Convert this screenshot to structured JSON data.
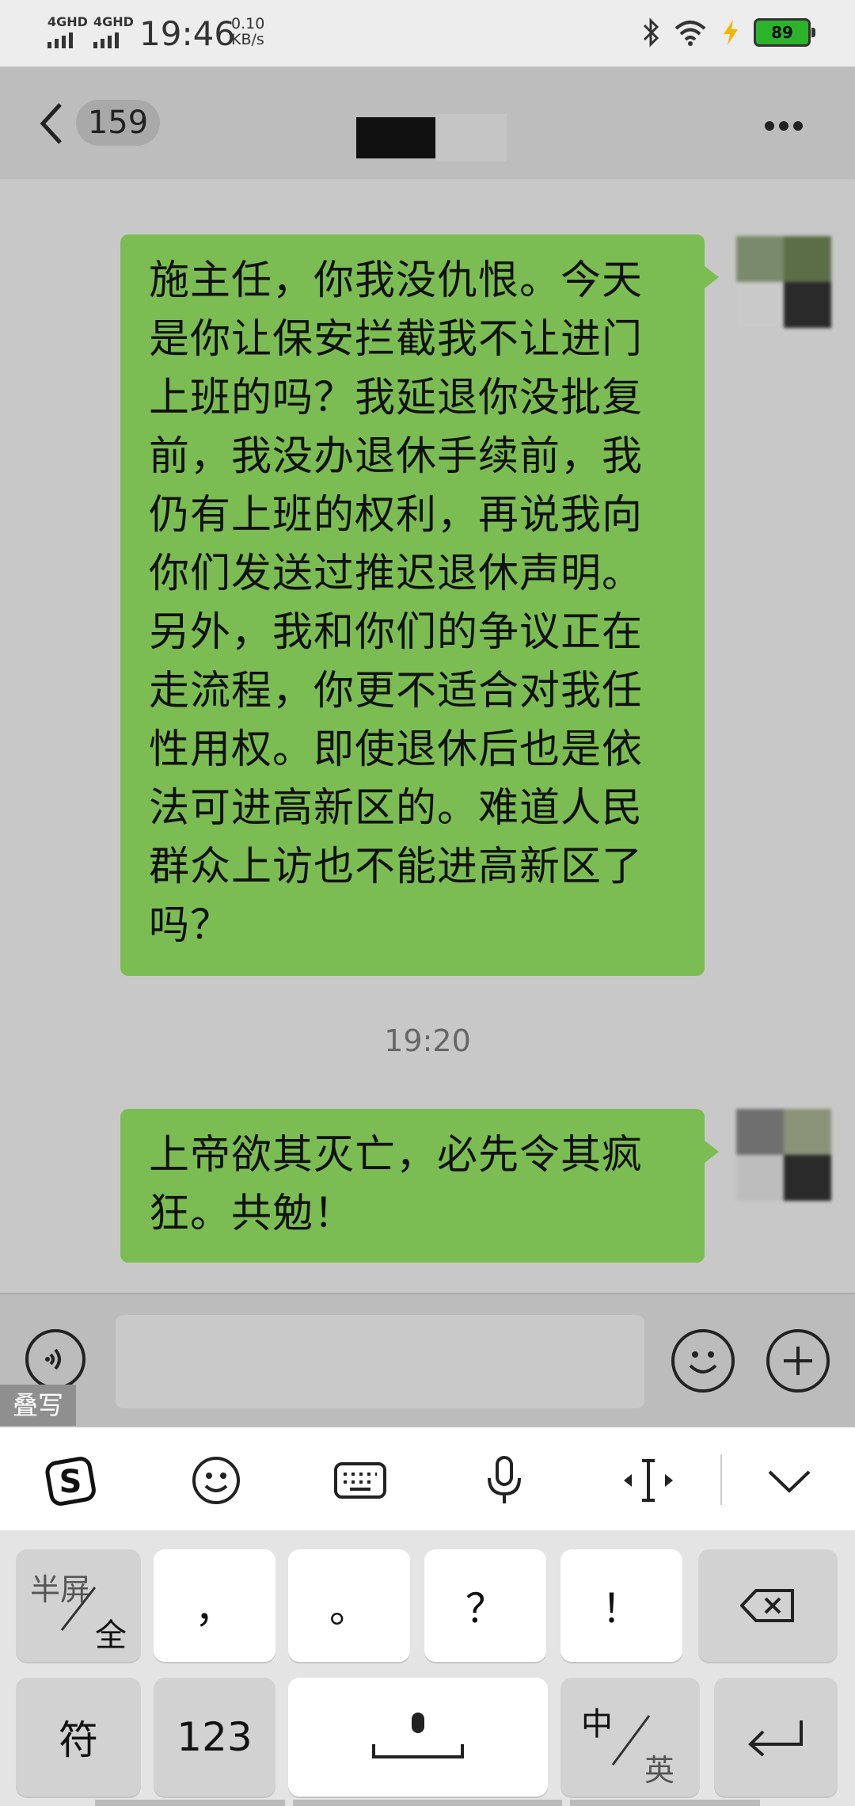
{
  "status_bar": {
    "network1": "4GHD",
    "network2": "4GHD",
    "time": "19:46",
    "speed_value": "0.10",
    "speed_unit": "KB/s",
    "battery": "89"
  },
  "header": {
    "unread_count": "159"
  },
  "messages": [
    {
      "text": "施主任，你我没仇恨。今天是你让保安拦截我不让进门上班的吗？我延退你没批复前，我没办退休手续前，我仍有上班的权利，再说我向你们发送过推迟退休声明。另外，我和你们的争议正在走流程，你更不适合对我任性用权。即使退休后也是依法可进高新区的。难道人民群众上访也不能进高新区了吗？"
    },
    {
      "text": "上帝欲其灭亡，必先令其疯狂。共勉！"
    }
  ],
  "timestamp": "19:20",
  "overlay_label": "叠写",
  "keyboard": {
    "half_full_top": "半屏",
    "half_full_bottom": "全",
    "comma": "，",
    "period": "。",
    "question": "？",
    "exclaim": "！",
    "symbols": "符",
    "numbers": "123",
    "lang_top": "中",
    "lang_bottom": "英"
  },
  "colors": {
    "bubble": "#7bbd52",
    "chat_bg": "#c8c8c8",
    "battery_fill": "#2bb32b"
  }
}
